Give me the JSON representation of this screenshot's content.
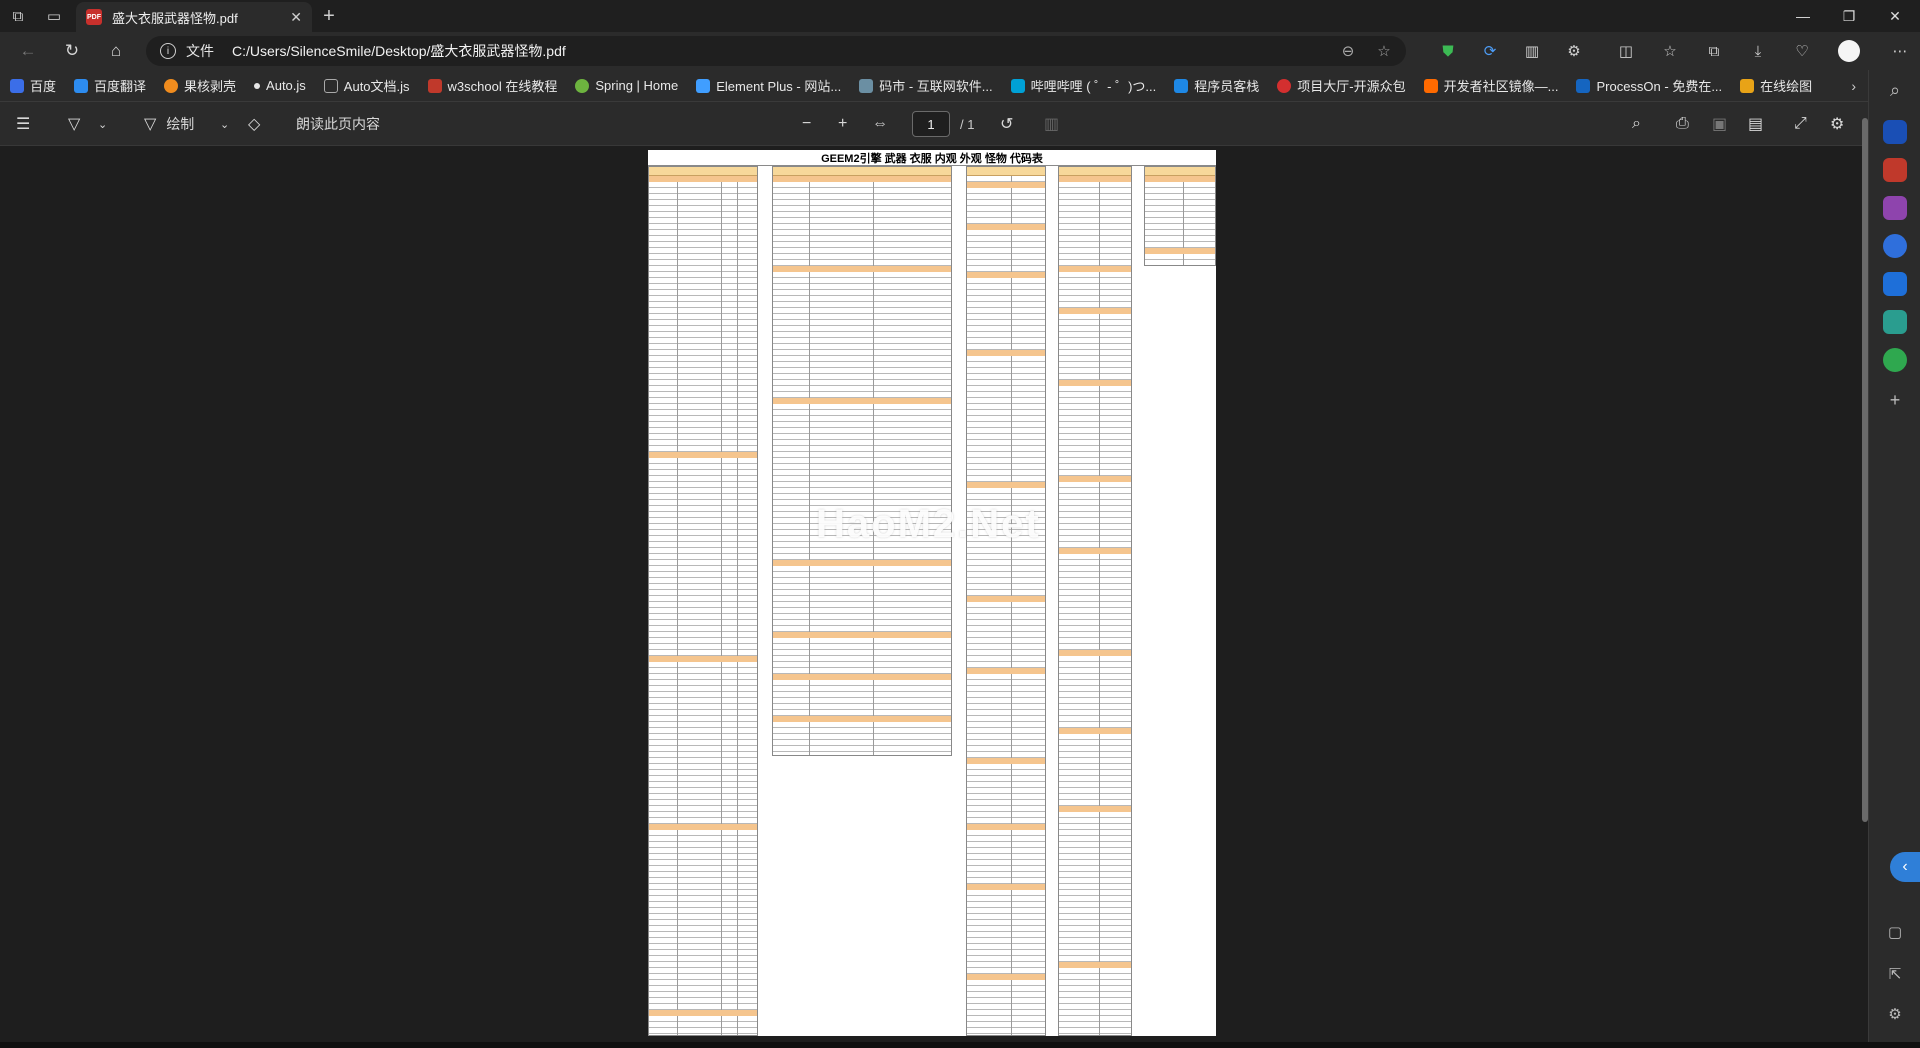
{
  "tab": {
    "title": "盛大衣服武器怪物.pdf",
    "badge": "PDF"
  },
  "address": {
    "scheme": "文件",
    "path": "C:/Users/SilenceSmile/Desktop/盛大衣服武器怪物.pdf"
  },
  "favorites": [
    {
      "label": "百度",
      "color": "#3b6ee8"
    },
    {
      "label": "百度翻译",
      "color": "#2d8cf0"
    },
    {
      "label": "果核剥壳",
      "color": "#f08c1e"
    },
    {
      "label": "Auto.js",
      "color": "#e6e6e6"
    },
    {
      "label": "Auto文档.js",
      "color": "#9a9a9a"
    },
    {
      "label": "w3school 在线教程",
      "color": "#c0392b"
    },
    {
      "label": "Spring | Home",
      "color": "#6db33f"
    },
    {
      "label": "Element Plus - 网站...",
      "color": "#409eff"
    },
    {
      "label": "码市 - 互联网软件...",
      "color": "#6b8fa3"
    },
    {
      "label": "哔哩哔哩 ( ゜- ゜)つ...",
      "color": "#00a1d6"
    },
    {
      "label": "程序员客栈",
      "color": "#1e88e5"
    },
    {
      "label": "项目大厅-开源众包",
      "color": "#d32f2f"
    },
    {
      "label": "开发者社区镜像—...",
      "color": "#ff6a00"
    },
    {
      "label": "ProcessOn - 免费在...",
      "color": "#1565c0"
    },
    {
      "label": "在线绘图",
      "color": "#e8a317"
    }
  ],
  "pdf_toolbar": {
    "draw_label": "绘制",
    "read_aloud_label": "朗读此页内容",
    "page_current": "1",
    "page_total": "/ 1"
  },
  "document": {
    "title": "GEEM2引擎 武器 衣服 内观 外观 怪物 代码表",
    "watermark": "HaoM2.Net"
  },
  "sidebar": {
    "colors": [
      "#1a4fb5",
      "#c0392b",
      "#8e44ad",
      "#2f6fdc",
      "#1e6fd9",
      "#2a9d8f",
      "#2fa84f"
    ]
  }
}
